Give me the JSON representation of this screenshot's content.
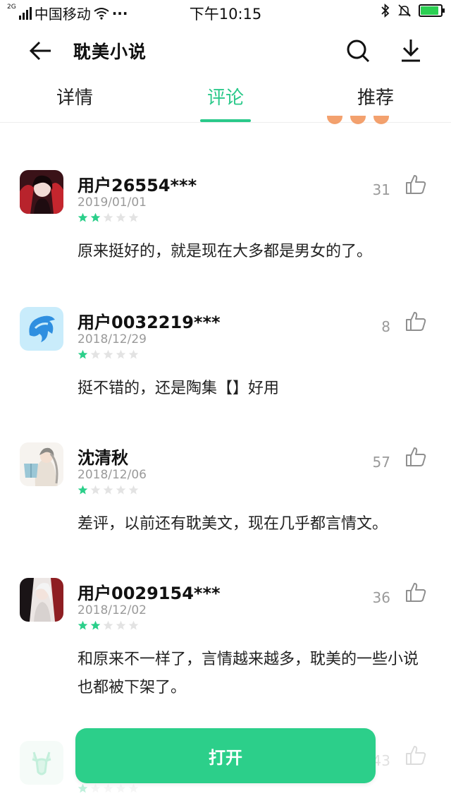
{
  "status_bar": {
    "network_type": "2G",
    "carrier": "中国移动",
    "more": "···",
    "time": "下午10:15",
    "battery_level": 0.9
  },
  "header": {
    "title": "耽美小说",
    "back_icon": "back-arrow-icon",
    "search_icon": "search-icon",
    "download_icon": "download-icon"
  },
  "tabs": [
    {
      "label": "详情",
      "active": false
    },
    {
      "label": "评论",
      "active": true
    },
    {
      "label": "推荐",
      "active": false
    }
  ],
  "colors": {
    "accent": "#2ac98a",
    "button": "#2ccf8a",
    "star_on": "#2bcf8a",
    "star_off": "#e3e3e3",
    "muted": "#9a9a9a"
  },
  "comments": [
    {
      "username": "用户26554***",
      "date": "2019/01/01",
      "rating": 2,
      "likes": "31",
      "text": "原来挺好的，就是现在大多都是男女的了。"
    },
    {
      "username": "用户0032219***",
      "date": "2018/12/29",
      "rating": 1,
      "likes": "8",
      "text": "挺不错的，还是陶集【】好用"
    },
    {
      "username": "沈清秋",
      "date": "2018/12/06",
      "rating": 1,
      "likes": "57",
      "text": "差评，以前还有耽美文，现在几乎都言情文。"
    },
    {
      "username": "用户0029154***",
      "date": "2018/12/02",
      "rating": 2,
      "likes": "36",
      "text": "和原来不一样了，言情越来越多，耽美的一些小说也都被下架了。"
    },
    {
      "username": "",
      "date": "",
      "rating": 1,
      "likes": "43",
      "text": ""
    }
  ],
  "open_button": {
    "label": "打开"
  }
}
